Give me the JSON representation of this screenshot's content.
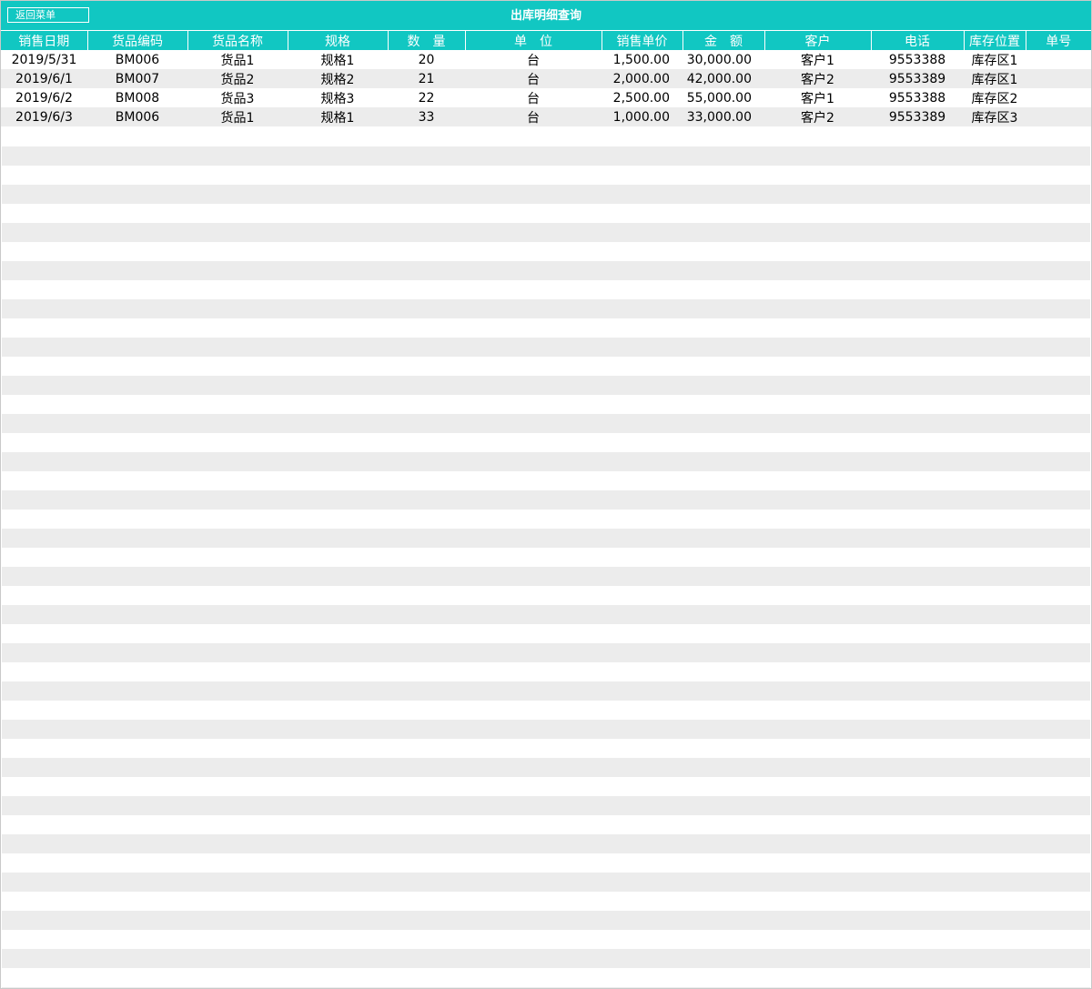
{
  "toolbar": {
    "back_label": "返回菜单",
    "title": "出库明细查询"
  },
  "table": {
    "headers": {
      "date": "销售日期",
      "code": "货品编码",
      "name": "货品名称",
      "spec": "规格",
      "qty": "数　量",
      "unit": "单　位",
      "price": "销售单价",
      "amount": "金　额",
      "customer": "客户",
      "phone": "电话",
      "location": "库存位置",
      "order_no": "单号"
    },
    "rows": [
      {
        "date": "2019/5/31",
        "code": "BM006",
        "name": "货品1",
        "spec": "规格1",
        "qty": "20",
        "unit": "台",
        "price": "1,500.00",
        "amount": "30,000.00",
        "customer": "客户1",
        "phone": "9553388",
        "location": "库存区1",
        "order_no": ""
      },
      {
        "date": "2019/6/1",
        "code": "BM007",
        "name": "货品2",
        "spec": "规格2",
        "qty": "21",
        "unit": "台",
        "price": "2,000.00",
        "amount": "42,000.00",
        "customer": "客户2",
        "phone": "9553389",
        "location": "库存区1",
        "order_no": ""
      },
      {
        "date": "2019/6/2",
        "code": "BM008",
        "name": "货品3",
        "spec": "规格3",
        "qty": "22",
        "unit": "台",
        "price": "2,500.00",
        "amount": "55,000.00",
        "customer": "客户1",
        "phone": "9553388",
        "location": "库存区2",
        "order_no": ""
      },
      {
        "date": "2019/6/3",
        "code": "BM006",
        "name": "货品1",
        "spec": "规格1",
        "qty": "33",
        "unit": "台",
        "price": "1,000.00",
        "amount": "33,000.00",
        "customer": "客户2",
        "phone": "9553389",
        "location": "库存区3",
        "order_no": ""
      }
    ]
  },
  "colors": {
    "header_bg": "#11c7c2",
    "header_text": "#ffffff",
    "stripe_alt": "#ececec"
  }
}
